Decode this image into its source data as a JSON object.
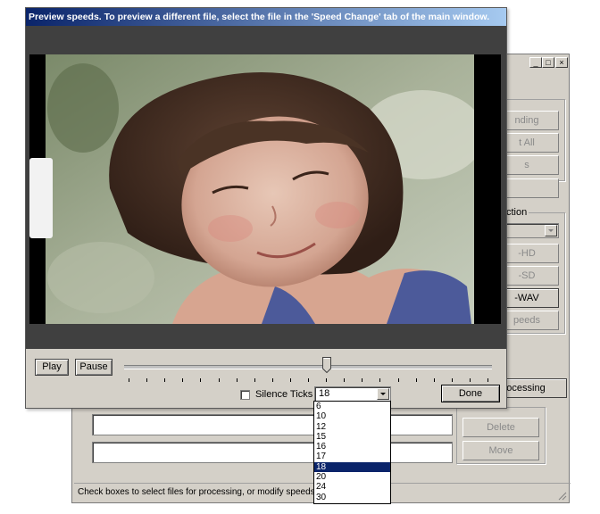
{
  "preview": {
    "title": "Preview speeds. To preview a different file, select the file in the 'Speed Change' tab of the main window.",
    "play_label": "Play",
    "pause_label": "Pause",
    "silence_ticks_label": "Silence Ticks",
    "speed_value": "18",
    "done_label": "Done",
    "slider_position": 0.55
  },
  "speed_options": [
    "6",
    "10",
    "12",
    "15",
    "16",
    "17",
    "18",
    "20",
    "24",
    "30"
  ],
  "main": {
    "buttons": {
      "b1": "nding",
      "b2": "t All",
      "b3": "s",
      "hd": "-HD",
      "sd": "-SD",
      "wav": "-WAV",
      "speeds": "peeds",
      "processing": "ocessing",
      "delete": "Delete",
      "move": "Move"
    },
    "group_label": "ction",
    "status_text": "Check boxes to select files for processing, or modify speeds for"
  },
  "colors": {
    "titlebar_start": "#0a246a",
    "titlebar_end": "#a6caf0",
    "selection": "#0a246a"
  }
}
